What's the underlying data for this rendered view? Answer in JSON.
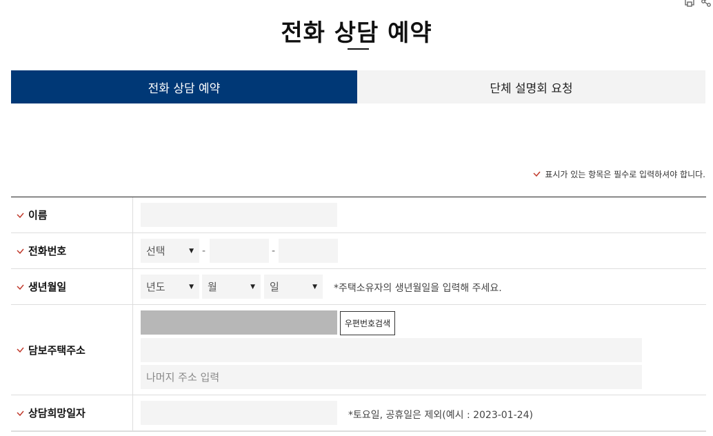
{
  "page": {
    "title": "전화 상담 예약"
  },
  "icons": {
    "print": "print-icon",
    "share": "share-icon",
    "required_check": "check-icon"
  },
  "colors": {
    "tab_active_bg": "#003876",
    "tab_inactive_bg": "#f3f3f3",
    "required_mark": "#c0392b",
    "input_bg": "#f4f4f4"
  },
  "tabs": [
    {
      "label": "전화 상담 예약",
      "active": true
    },
    {
      "label": "단체 설명회 요청",
      "active": false
    }
  ],
  "required_note": "표시가 있는 항목은 필수로 입력하셔야 합니다.",
  "form": {
    "name": {
      "label": "이름",
      "value": ""
    },
    "phone": {
      "label": "전화번호",
      "prefix_select": "선택",
      "separator": "-",
      "middle_value": "",
      "last_value": ""
    },
    "birth": {
      "label": "생년월일",
      "year_select": "년도",
      "month_select": "월",
      "day_select": "일",
      "hint": "*주택소유자의 생년월일을 입력해 주세요."
    },
    "address": {
      "label": "담보주택주소",
      "zip_value": "",
      "zip_button": "우편번호검색",
      "address1_value": "",
      "address2_placeholder": "나머지 주소 입력"
    },
    "date": {
      "label": "상담희망일자",
      "value": "",
      "hint": "*토요일, 공휴일은 제외(예시 : 2023-01-24)"
    }
  }
}
